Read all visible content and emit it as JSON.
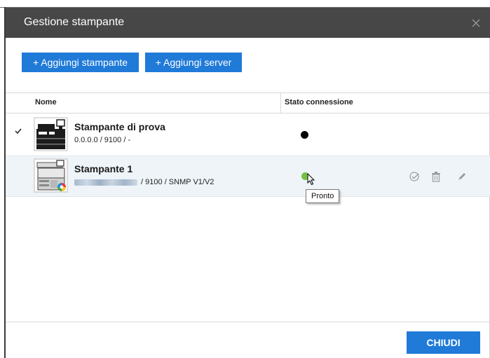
{
  "dialog": {
    "title": "Gestione stampante"
  },
  "toolbar": {
    "add_printer_label": "+ Aggiungi stampante",
    "add_server_label": "+ Aggiungi server"
  },
  "table": {
    "columns": [
      "Nome",
      "Stato connessione"
    ],
    "rows": [
      {
        "name": "Stampante di prova",
        "address": "0.0.0.0 / 9100 / -",
        "selected": true,
        "status_color": "#000000"
      },
      {
        "name": "Stampante 1",
        "address_suffix": " / 9100 / SNMP V1/V2",
        "selected": false,
        "status_color": "#74c043",
        "status_tooltip": "Pronto",
        "actions": [
          "check-circle-icon",
          "trash-icon",
          "edit-icon"
        ]
      }
    ]
  },
  "footer": {
    "close_label": "CHIUDI"
  },
  "colors": {
    "titlebar": "#474747",
    "accent": "#1f7ad8",
    "highlight_row": "#eef4f8"
  }
}
